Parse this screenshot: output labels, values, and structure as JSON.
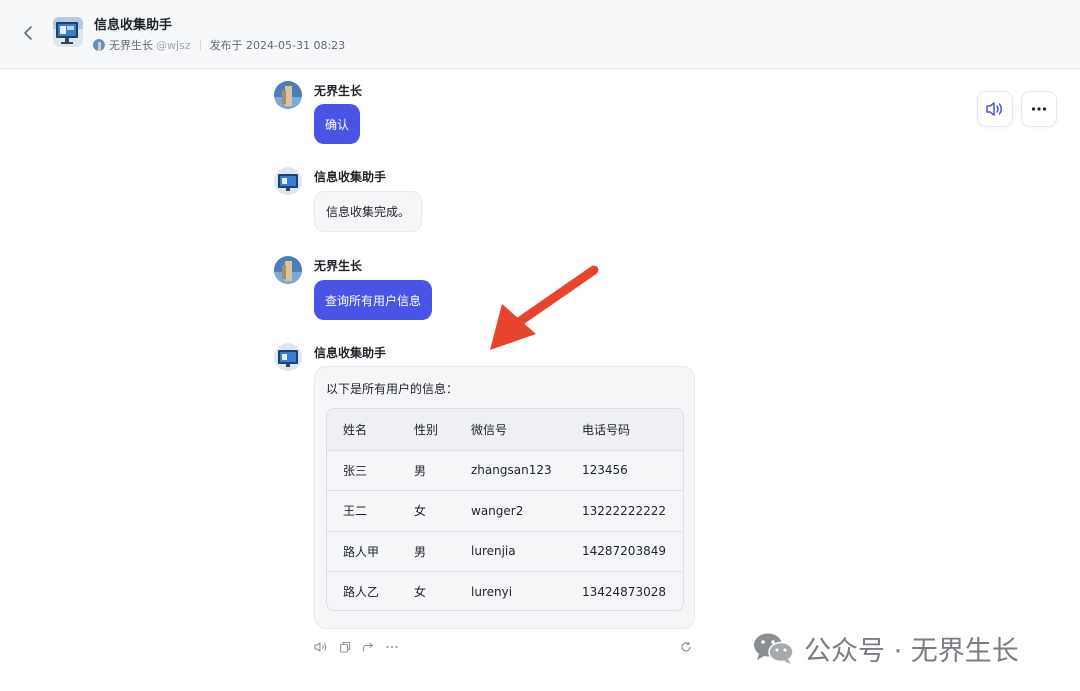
{
  "header": {
    "title": "信息收集助手",
    "author": "无界生长",
    "handle": "@wjsz",
    "published": "发布于 2024-05-31 08:23"
  },
  "messages": [
    {
      "role": "user",
      "sender": "无界生长",
      "text": "确认"
    },
    {
      "role": "bot",
      "sender": "信息收集助手",
      "text": "信息收集完成。"
    },
    {
      "role": "user",
      "sender": "无界生长",
      "text": "查询所有用户信息"
    },
    {
      "role": "bot",
      "sender": "信息收集助手",
      "text": "以下是所有用户的信息："
    }
  ],
  "table": {
    "columns": [
      "姓名",
      "性别",
      "微信号",
      "电话号码"
    ],
    "rows": [
      [
        "张三",
        "男",
        "zhangsan123",
        "123456"
      ],
      [
        "王二",
        "女",
        "wanger2",
        "13222222222"
      ],
      [
        "路人甲",
        "男",
        "lurenjia",
        "14287203849"
      ],
      [
        "路人乙",
        "女",
        "lurenyi",
        "13424873028"
      ]
    ]
  },
  "watermark": "公众号 · 无界生长",
  "colors": {
    "accent": "#4954e6",
    "arrow": "#e8432e"
  },
  "icons": [
    "back-chevron-icon",
    "speaker-icon",
    "more-icon",
    "copy-icon",
    "share-icon",
    "refresh-icon",
    "wechat-icon"
  ]
}
